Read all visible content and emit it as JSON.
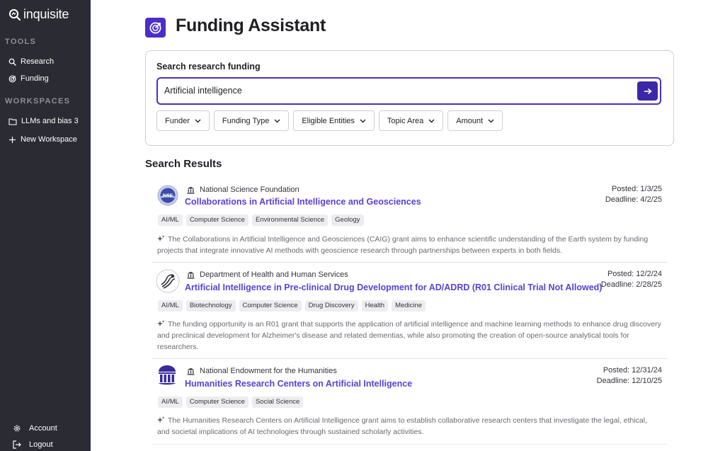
{
  "app": {
    "logo_text": "inquisite"
  },
  "sidebar": {
    "tools_label": "TOOLS",
    "tools": [
      {
        "label": "Research",
        "icon": "search-icon"
      },
      {
        "label": "Funding",
        "icon": "target-icon"
      }
    ],
    "workspaces_label": "WORKSPACES",
    "workspaces": [
      {
        "label": "LLMs and bias 3",
        "icon": "folder-icon"
      },
      {
        "label": "New Workspace",
        "icon": "plus-icon"
      }
    ],
    "footer": [
      {
        "label": "Account",
        "icon": "gear-icon"
      },
      {
        "label": "Logout",
        "icon": "logout-icon"
      }
    ]
  },
  "page": {
    "title": "Funding Assistant"
  },
  "search": {
    "label": "Search research funding",
    "value": "Artificial intelligence",
    "filters": [
      "Funder",
      "Funding Type",
      "Eligible Entities",
      "Topic Area",
      "Amount"
    ]
  },
  "results": {
    "title": "Search Results",
    "items": [
      {
        "funder": "National Science Foundation",
        "title": "Collaborations in Artificial Intelligence and Geosciences",
        "posted": "Posted: 1/3/25",
        "deadline": "Deadline: 4/2/25",
        "tags": [
          "AI/ML",
          "Computer Science",
          "Environmental Science",
          "Geology"
        ],
        "summary": "The Collaborations in Artificial Intelligence and Geosciences (CAIG) grant aims to enhance scientific understanding of the Earth system by funding projects that integrate innovative AI methods with geoscience research through partnerships between experts in both fields."
      },
      {
        "funder": "Department of Health and Human Services",
        "title": "Artificial Intelligence in Pre-clinical Drug Development for AD/ADRD (R01 Clinical Trial Not Allowed)",
        "posted": "Posted: 12/2/24",
        "deadline": "Deadline: 2/28/25",
        "tags": [
          "AI/ML",
          "Biotechnology",
          "Computer Science",
          "Drug Discovery",
          "Health",
          "Medicine"
        ],
        "summary": "The funding opportunity is an R01 grant that supports the application of artificial intelligence and machine learning methods to enhance drug discovery and preclinical development for Alzheimer's disease and related dementias, while also promoting the creation of open-source analytical tools for researchers."
      },
      {
        "funder": "National Endowment for the Humanities",
        "title": "Humanities Research Centers on Artificial Intelligence",
        "posted": "Posted: 12/31/24",
        "deadline": "Deadline: 12/10/25",
        "tags": [
          "AI/ML",
          "Computer Science",
          "Social Science"
        ],
        "summary": "The Humanities Research Centers on Artificial Intelligence grant aims to establish collaborative research centers that investigate the legal, ethical, and societal implications of AI technologies through sustained scholarly activities."
      }
    ]
  },
  "colors": {
    "sidebar_bg": "#2b2b33",
    "accent": "#4a2ec7",
    "link": "#5b3fd6"
  }
}
